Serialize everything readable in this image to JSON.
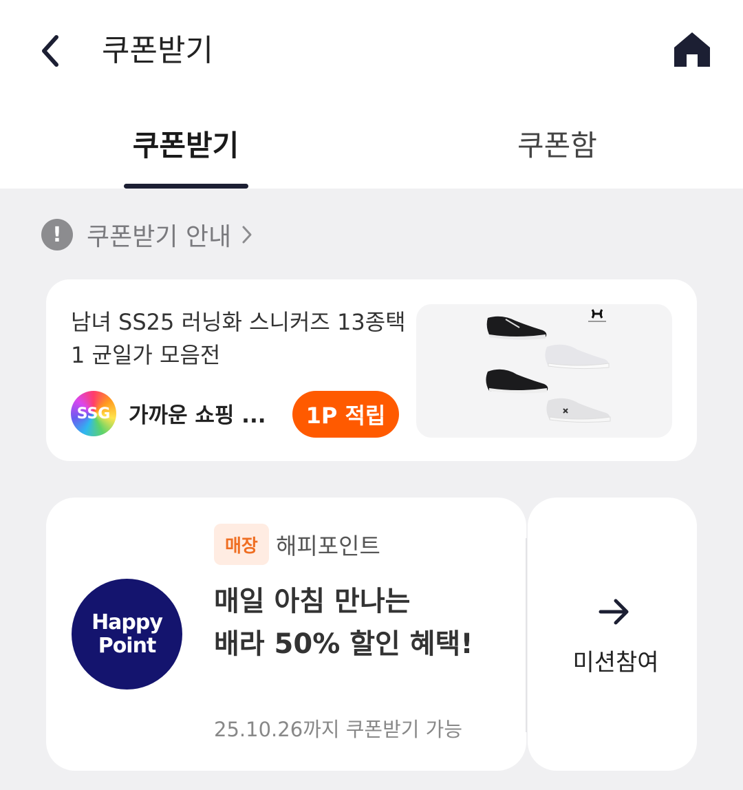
{
  "header": {
    "title": "쿠폰받기",
    "back_icon": "chevron-left-icon",
    "home_icon": "home-icon"
  },
  "tabs": [
    {
      "label": "쿠폰받기",
      "active": true
    },
    {
      "label": "쿠폰함",
      "active": false
    }
  ],
  "guide": {
    "label": "쿠폰받기 안내",
    "icon": "alert-icon",
    "icon_text": "!"
  },
  "promo_card": {
    "title": "남녀 SS25 러닝화 스니커즈 13종택1 균일가 모음전",
    "store_logo_text": "SSG",
    "store_name": "가까운 쇼핑 ...",
    "point_badge": "1P 적립",
    "image": "sneakers-product-image",
    "image_brand_icon": "under-armour-logo"
  },
  "coupon_card": {
    "logo_line1": "Happy",
    "logo_line2": "Point",
    "tag": "매장",
    "brand": "해피포인트",
    "offer_line1": "매일 아침 만나는",
    "offer_line2": "배라 50% 할인 혜택!",
    "expiry": "25.10.26까지 쿠폰받기 가능",
    "action_icon": "arrow-right-icon",
    "action_label": "미션참여"
  },
  "colors": {
    "accent_orange": "#ff5a00",
    "navy": "#1c1f33",
    "happy_point_blue": "#14146e",
    "tag_bg": "#ffece2",
    "tag_text": "#ef6e22"
  }
}
